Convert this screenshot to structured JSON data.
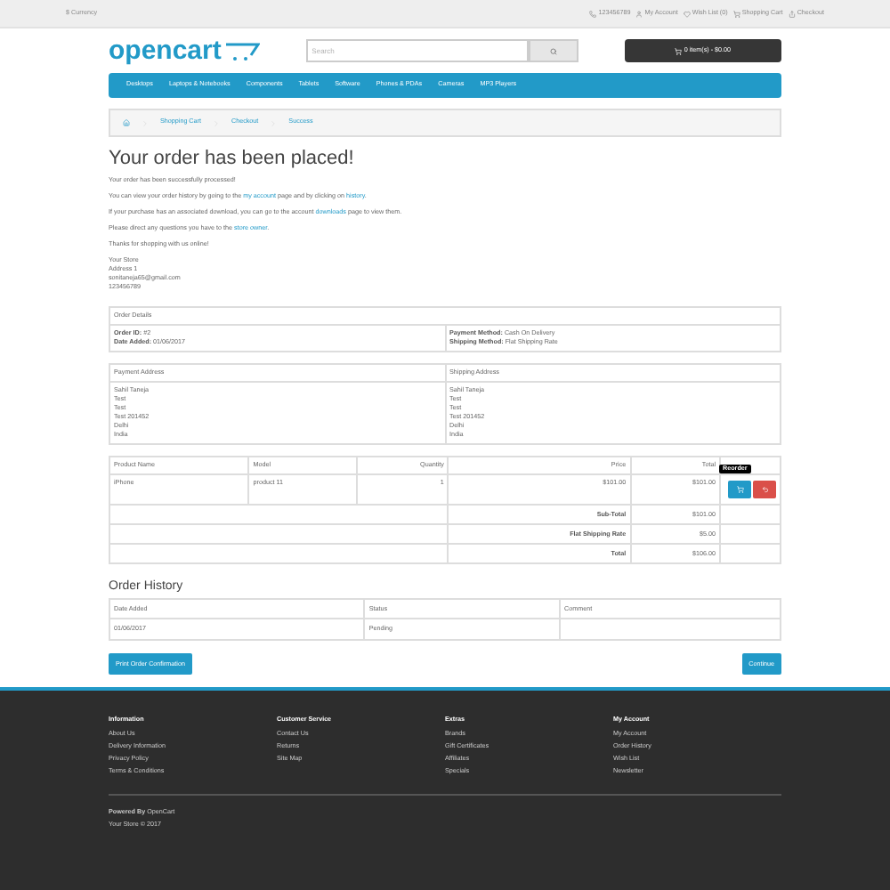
{
  "top_bar": {
    "currency": "$ Currency",
    "links": [
      {
        "kind": "phone",
        "label": "123456789"
      },
      {
        "kind": "account",
        "label": "My Account"
      },
      {
        "kind": "wishlist",
        "label": "Wish List (0)"
      },
      {
        "kind": "cart",
        "label": "Shopping Cart"
      },
      {
        "kind": "checkout",
        "label": "Checkout"
      }
    ]
  },
  "header": {
    "logo": "opencart",
    "search": {
      "placeholder": "Search"
    },
    "cart_button": "0 item(s) - $0.00"
  },
  "nav": [
    "Desktops",
    "Laptops & Notebooks",
    "Components",
    "Tablets",
    "Software",
    "Phones & PDAs",
    "Cameras",
    "MP3 Players"
  ],
  "breadcrumb": [
    "Shopping Cart",
    "Checkout",
    "Success"
  ],
  "title": "Your order has been placed!",
  "paragraphs": [
    [
      {
        "t": "Your order has been successfully processed!"
      }
    ],
    [
      {
        "t": "You can view your order history by going to the "
      },
      {
        "t": "my account",
        "link": true
      },
      {
        "t": " page and by clicking on "
      },
      {
        "t": "history",
        "link": true
      },
      {
        "t": "."
      }
    ],
    [
      {
        "t": "If your purchase has an associated download, you can go to the account "
      },
      {
        "t": "downloads",
        "link": true
      },
      {
        "t": " page to view them."
      }
    ],
    [
      {
        "t": "Please direct any questions you have to the "
      },
      {
        "t": "store owner",
        "link": true
      },
      {
        "t": "."
      }
    ],
    [
      {
        "t": "Thanks for shopping with us online!"
      }
    ]
  ],
  "store_address": [
    "Your Store",
    "Address 1",
    "sonitaneja65@gmail.com",
    "123456789"
  ],
  "order_details": {
    "heading": "Order Details",
    "left": [
      {
        "label": "Order ID:",
        "value": "#2"
      },
      {
        "label": "Date Added:",
        "value": "01/06/2017"
      }
    ],
    "right": [
      {
        "label": "Payment Method:",
        "value": "Cash On Delivery"
      },
      {
        "label": "Shipping Method:",
        "value": "Flat Shipping Rate"
      }
    ]
  },
  "addresses": {
    "columns": [
      "Payment Address",
      "Shipping Address"
    ],
    "payment": [
      "Sahil Taneja",
      "Test",
      "Test",
      "Test 201452",
      "Delhi",
      "India"
    ],
    "shipping": [
      "Sahil Taneja",
      "Test",
      "Test",
      "Test 201452",
      "Delhi",
      "India"
    ]
  },
  "products": {
    "columns": [
      "Product Name",
      "Model",
      "Quantity",
      "Price",
      "Total"
    ],
    "rows": [
      {
        "name": "iPhone",
        "model": "product 11",
        "quantity": "1",
        "price": "$101.00",
        "total": "$101.00"
      }
    ],
    "tooltip": "Reorder",
    "totals": [
      {
        "label": "Sub-Total",
        "value": "$101.00"
      },
      {
        "label": "Flat Shipping Rate",
        "value": "$5.00"
      },
      {
        "label": "Total",
        "value": "$106.00"
      }
    ]
  },
  "history": {
    "title": "Order History",
    "columns": [
      "Date Added",
      "Status",
      "Comment"
    ],
    "rows": [
      {
        "date": "01/06/2017",
        "status": "Pending"
      }
    ]
  },
  "buttons": {
    "print": "Print Order Confirmation",
    "continue": "Continue"
  },
  "footer": {
    "columns": [
      {
        "title": "Information",
        "links": [
          "About Us",
          "Delivery Information",
          "Privacy Policy",
          "Terms & Conditions"
        ]
      },
      {
        "title": "Customer Service",
        "links": [
          "Contact Us",
          "Returns",
          "Site Map"
        ]
      },
      {
        "title": "Extras",
        "links": [
          "Brands",
          "Gift Certificates",
          "Affiliates",
          "Specials"
        ]
      },
      {
        "title": "My Account",
        "links": [
          "My Account",
          "Order History",
          "Wish List",
          "Newsletter"
        ]
      }
    ],
    "powered_prefix": "Powered By",
    "powered_link": "OpenCart",
    "copyright": "Your Store © 2017"
  }
}
